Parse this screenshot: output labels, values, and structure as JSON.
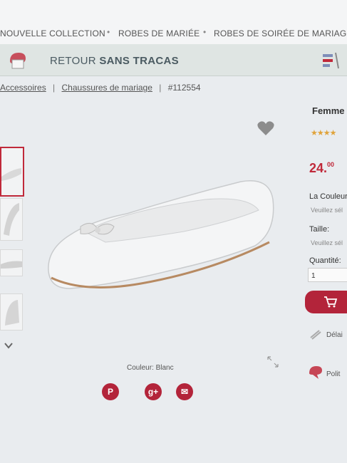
{
  "nav": {
    "items": [
      "NOUVELLE COLLECTION",
      "ROBES DE MARIÉE",
      "ROBES DE SOIRÉE DE MARIAGE"
    ],
    "separator": "•"
  },
  "banner": {
    "text_normal": "RETOUR",
    "text_bold": "SANS TRACAS"
  },
  "breadcrumb": {
    "items": [
      "Accessoires",
      "Chaussures de mariage",
      "#112554"
    ],
    "separator": "|"
  },
  "product": {
    "title": "Femme",
    "stars": "★★★★",
    "price_main": "24.",
    "price_cents": "00",
    "color_label": "Couleur: Blanc",
    "color_option_label": "La Couleur",
    "color_option_hint": "Veuillez sél",
    "size_label": "Taille:",
    "size_hint": "Veuillez sél",
    "quantity_label": "Quantité:",
    "quantity_value": "1",
    "delivery_label": "Délai",
    "policy_label": "Polit"
  },
  "social": [
    "P",
    "g+",
    "✉"
  ],
  "colors": {
    "accent": "#c0293a",
    "social": "#b3243a",
    "banner": "#dfe5e3"
  }
}
